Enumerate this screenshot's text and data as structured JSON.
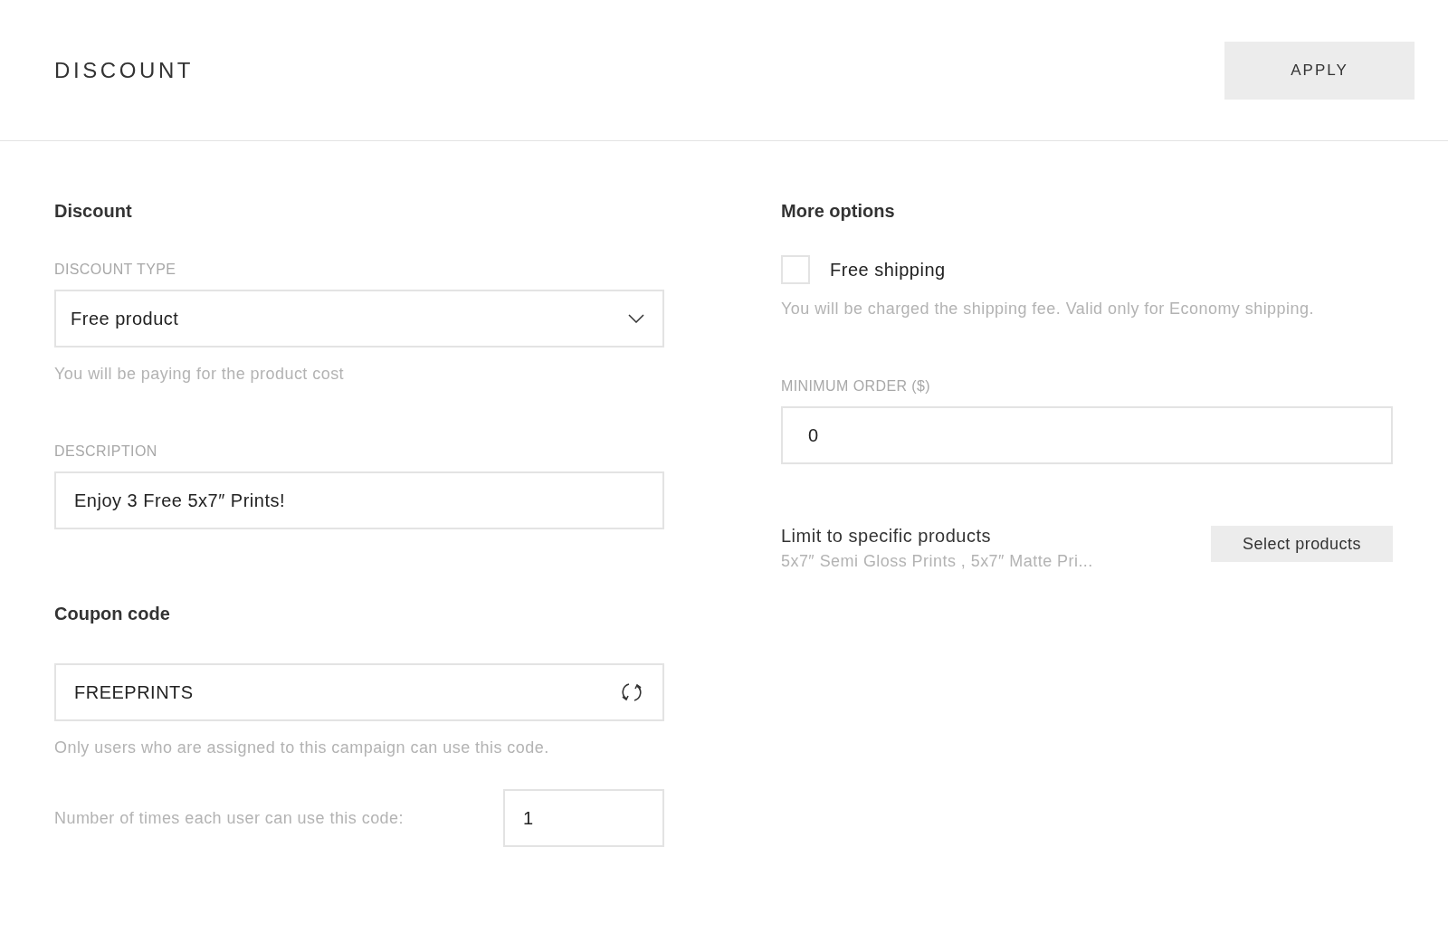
{
  "header": {
    "title": "DISCOUNT",
    "apply_button": "APPLY"
  },
  "discount": {
    "heading": "Discount",
    "type_label": "DISCOUNT TYPE",
    "type_value": "Free product",
    "type_hint": "You will be paying for the product cost",
    "description_label": "DESCRIPTION",
    "description_value": "Enjoy 3 Free 5x7″ Prints!"
  },
  "coupon": {
    "heading": "Coupon code",
    "code_value": "FREEPRINTS",
    "code_hint": "Only users who are assigned to this campaign can use this code.",
    "uses_label": "Number of times each user can use this code:",
    "uses_value": "1"
  },
  "more_options": {
    "heading": "More options",
    "free_shipping": {
      "label": "Free shipping",
      "checked": false
    },
    "shipping_hint": "You will be charged the shipping fee. Valid only for Economy shipping.",
    "minimum_label": "MINIMUM ORDER ($)",
    "minimum_value": "0",
    "limit_label": "Limit to specific products",
    "limit_products": "5x7″ Semi Gloss Prints , 5x7″ Matte Pri...",
    "select_button": "Select products"
  }
}
